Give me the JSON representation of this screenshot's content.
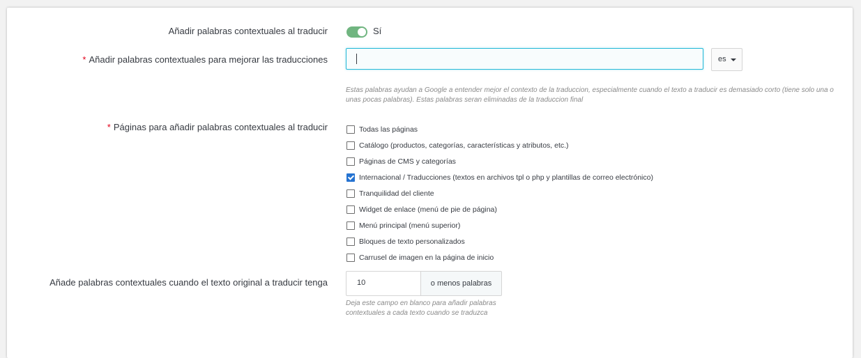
{
  "form": {
    "context_toggle": {
      "label": "Añadir palabras contextuales al traducir",
      "state_text": "Sí"
    },
    "context_words": {
      "required_mark": "*",
      "label": "Añadir palabras contextuales para mejorar las traducciones",
      "value": "",
      "language": "es",
      "help": "Estas palabras ayudan a Google a entender mejor el contexto de la traduccion, especialmente cuando el texto a traducir es demasiado corto (tiene solo una o unas pocas palabras). Estas palabras seran eliminadas de la traduccion final"
    },
    "pages": {
      "required_mark": "*",
      "label": "Páginas para añadir palabras contextuales al traducir",
      "options": [
        {
          "label": "Todas las páginas",
          "checked": false
        },
        {
          "label": "Catálogo (productos, categorías, características y atributos, etc.)",
          "checked": false
        },
        {
          "label": "Páginas de CMS y categorías",
          "checked": false
        },
        {
          "label": "Internacional / Traducciones (textos en archivos tpl o php y plantillas de correo electrónico)",
          "checked": true
        },
        {
          "label": "Tranquilidad del cliente",
          "checked": false
        },
        {
          "label": "Widget de enlace (menú de pie de página)",
          "checked": false
        },
        {
          "label": "Menú principal (menú superior)",
          "checked": false
        },
        {
          "label": "Bloques de texto personalizados",
          "checked": false
        },
        {
          "label": "Carrusel de imagen en la página de inicio",
          "checked": false
        }
      ]
    },
    "min_words": {
      "label": "Añade palabras contextuales cuando el texto original a traducir tenga",
      "value": "10",
      "suffix": "o menos palabras",
      "help": "Deja este campo en blanco para añadir palabras contextuales a cada texto cuando se traduzca"
    }
  },
  "colors": {
    "toggle_on": "#70b580",
    "focus_border": "#25b9d7",
    "required": "#e2001a",
    "checkbox_checked": "#2573d1"
  }
}
